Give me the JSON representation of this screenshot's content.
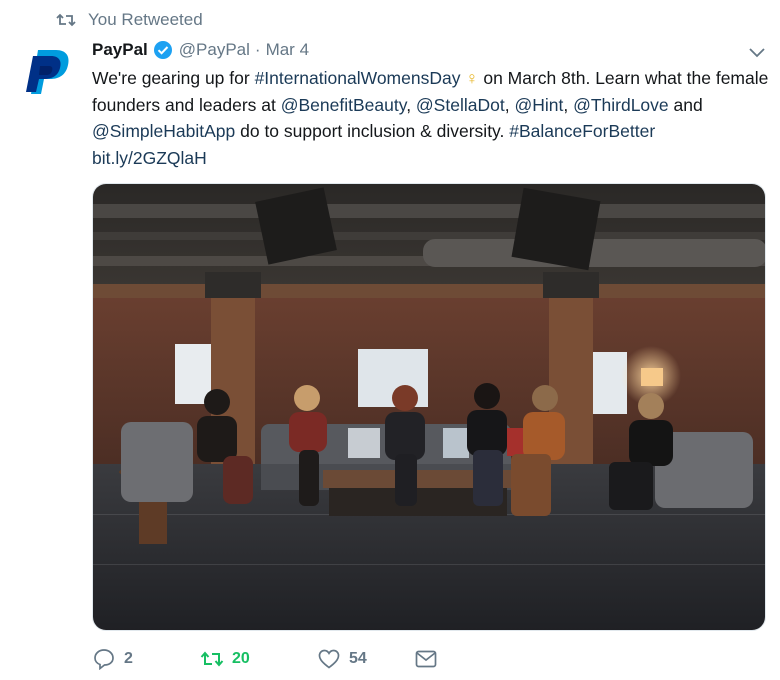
{
  "retweet_context": {
    "icon": "retweet-icon",
    "label": "You Retweeted"
  },
  "author": {
    "avatar_icon": "paypal-logo",
    "name": "PayPal",
    "verified_icon": "verified-badge-icon",
    "handle": "@PayPal",
    "separator": "·",
    "date": "Mar 4"
  },
  "tweet": {
    "text_parts": {
      "p1": "We're gearing up for ",
      "hashtag1": "#InternationalWomensDay",
      "venus": "♀",
      "p2": " on March 8th. Learn what the female founders and leaders at ",
      "mention1": "@BenefitBeauty",
      "comma1": ", ",
      "mention2": "@StellaDot",
      "comma2": ", ",
      "mention3": "@Hint",
      "comma3": ", ",
      "mention4": "@ThirdLove",
      "p3": " and ",
      "mention5": "@SimpleHabitApp",
      "p4": " do to support inclusion & diversity. ",
      "hashtag2": "#BalanceForBetter",
      "space": " ",
      "link": "bit.ly/2GZQlaH"
    },
    "media_icon": "photo-women-panel"
  },
  "actions": {
    "reply": {
      "icon": "reply-icon",
      "count": "2"
    },
    "retweet": {
      "icon": "retweet-icon",
      "count": "20",
      "color": "#17bf63"
    },
    "like": {
      "icon": "heart-icon",
      "count": "54"
    },
    "dm": {
      "icon": "envelope-icon"
    }
  },
  "menu": {
    "icon": "chevron-down-icon"
  },
  "colors": {
    "text": "#14171a",
    "muted": "#657786",
    "link": "#1b3a57",
    "verified": "#1da1f2",
    "retweet_active": "#17bf63",
    "paypal_dark": "#003087",
    "paypal_light": "#009cde"
  }
}
